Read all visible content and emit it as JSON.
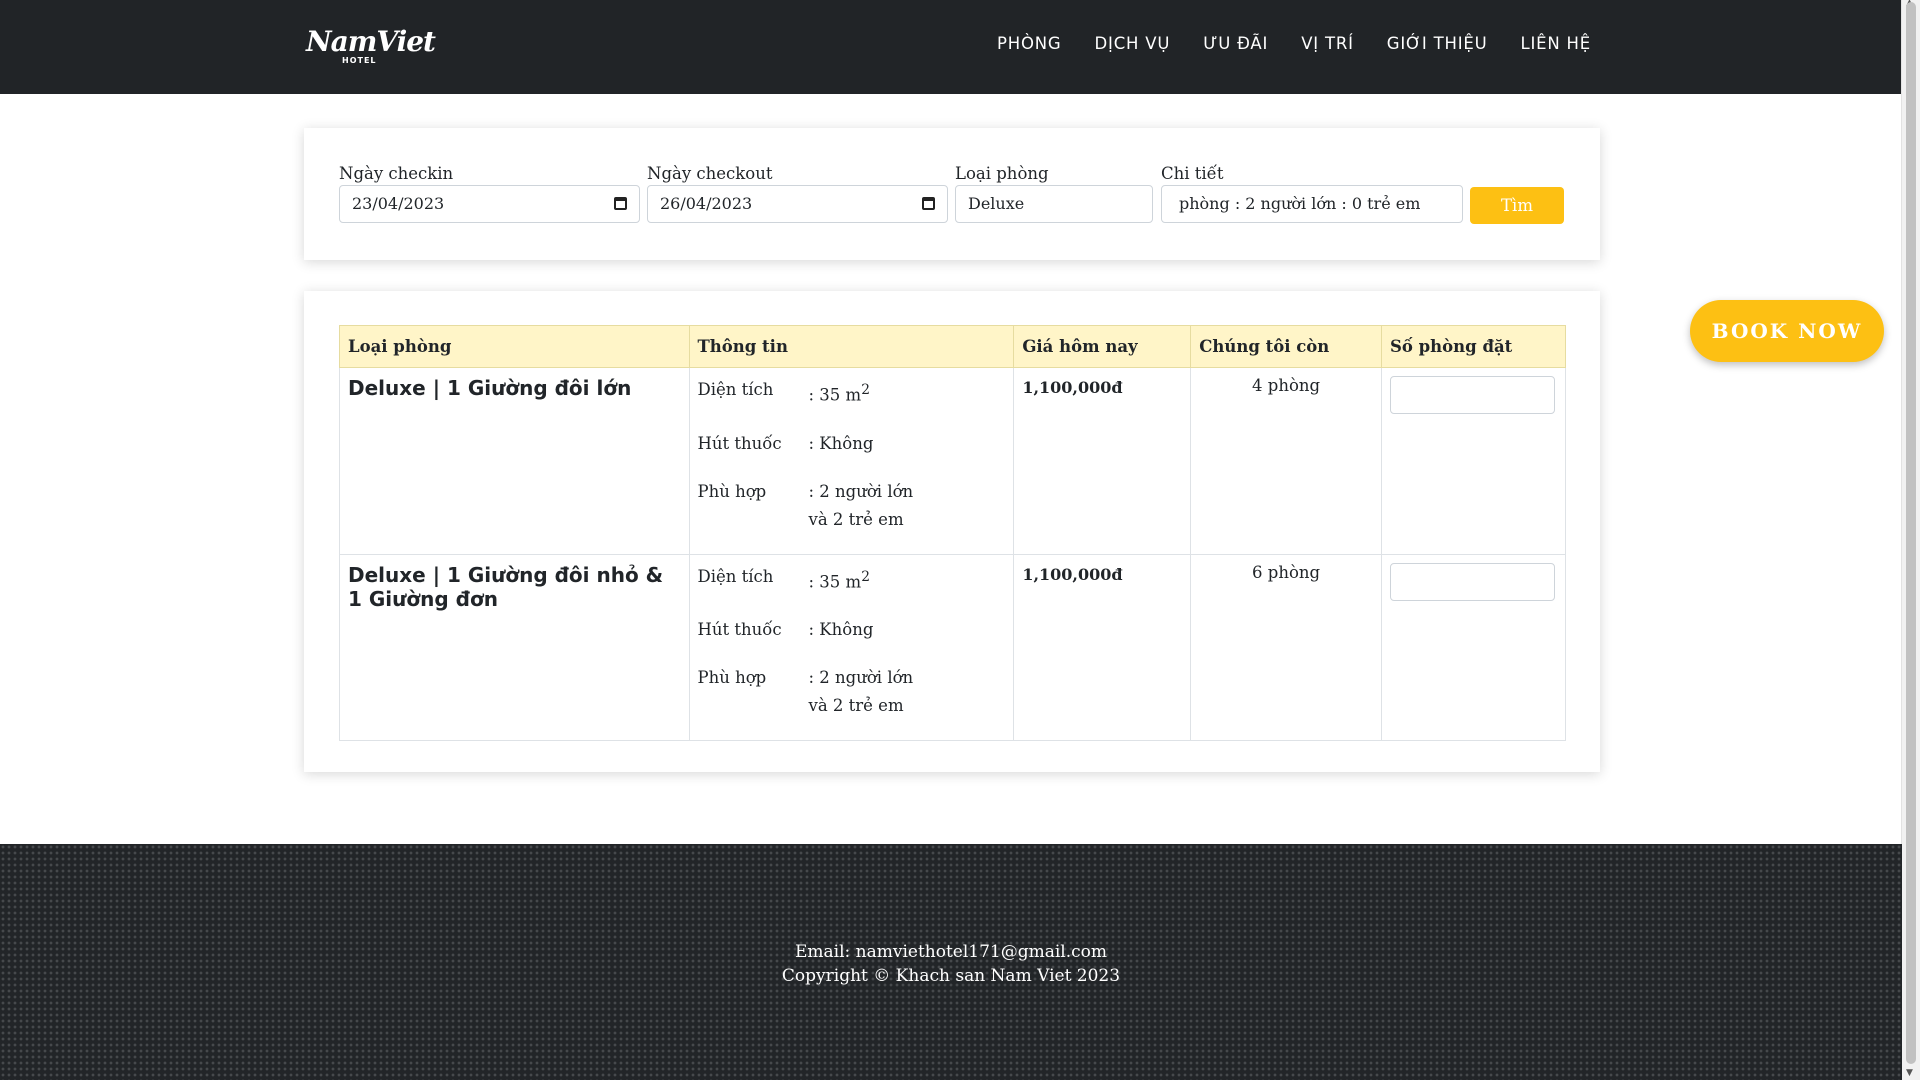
{
  "header": {
    "logo_text": "NamViet",
    "logo_sub": "HOTEL",
    "nav": [
      "PHÒNG",
      "DỊCH VỤ",
      "ƯU ĐÃI",
      "VỊ TRÍ",
      "GIỚI THIỆU",
      "LIÊN HỆ"
    ]
  },
  "search": {
    "checkin_label": "Ngày checkin",
    "checkin_value": "23/04/2023",
    "checkout_label": "Ngày checkout",
    "checkout_value": "26/04/2023",
    "room_type_label": "Loại phòng",
    "room_type_value": "Deluxe",
    "detail_label": "Chi tiết",
    "detail_value": "phòng : 2 người lớn : 0 trẻ em",
    "find_button": "Tìm"
  },
  "table": {
    "headers": [
      "Loại phòng",
      "Thông tin",
      "Giá hôm nay",
      "Chúng tôi còn",
      "Số phòng đặt"
    ],
    "rows": [
      {
        "name": "Deluxe | 1 Giường đôi lớn",
        "area_label": "Diện tích",
        "area_value": ": 35 m",
        "area_sup": "2",
        "smoking_label": "Hút thuốc",
        "smoking_value": ": Không",
        "fit_label": "Phù hợp",
        "fit_value_1": ": 2 người lớn",
        "fit_value_2": "và 2 trẻ em",
        "price": "1,100,000đ",
        "available": "4 phòng"
      },
      {
        "name": "Deluxe | 1 Giường đôi nhỏ & 1 Giường đơn",
        "area_label": "Diện tích",
        "area_value": ": 35 m",
        "area_sup": "2",
        "smoking_label": "Hút thuốc",
        "smoking_value": ": Không",
        "fit_label": "Phù hợp",
        "fit_value_1": ": 2 người lớn",
        "fit_value_2": "và 2 trẻ em",
        "price": "1,100,000đ",
        "available": "6 phòng"
      }
    ]
  },
  "book_now": "BOOK NOW",
  "footer": {
    "email": "Email: namviethotel171@gmail.com",
    "copyright": "Copyright © Khach san Nam Viet 2023"
  },
  "colors": {
    "accent": "#fdc013",
    "header_bg": "#212427",
    "table_header_bg": "#fff5c8"
  }
}
